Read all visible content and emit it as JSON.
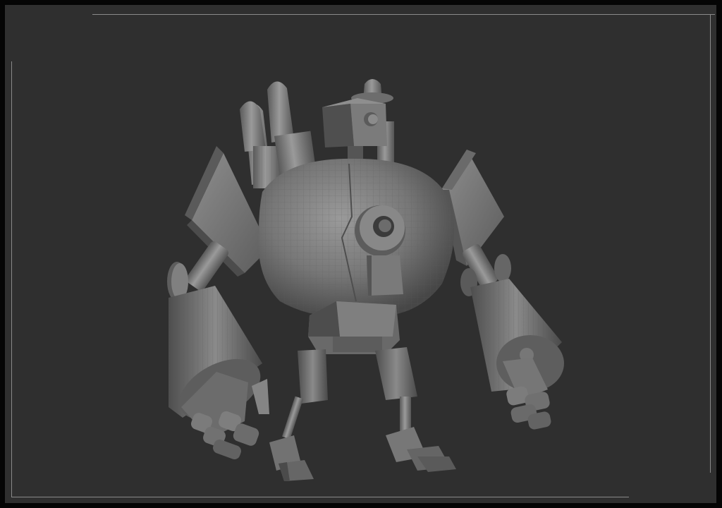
{
  "viewport": {
    "model": "robot-sculpt-mesh",
    "colors": {
      "background": "#2f2f2f",
      "outer_border": "#050505",
      "frame_line": "#8a8a8a",
      "mesh_light": "#8d8d8d",
      "mesh_mid": "#6e6e6e",
      "mesh_dark": "#4a4a4a",
      "wire": "#5a5a5a"
    }
  }
}
